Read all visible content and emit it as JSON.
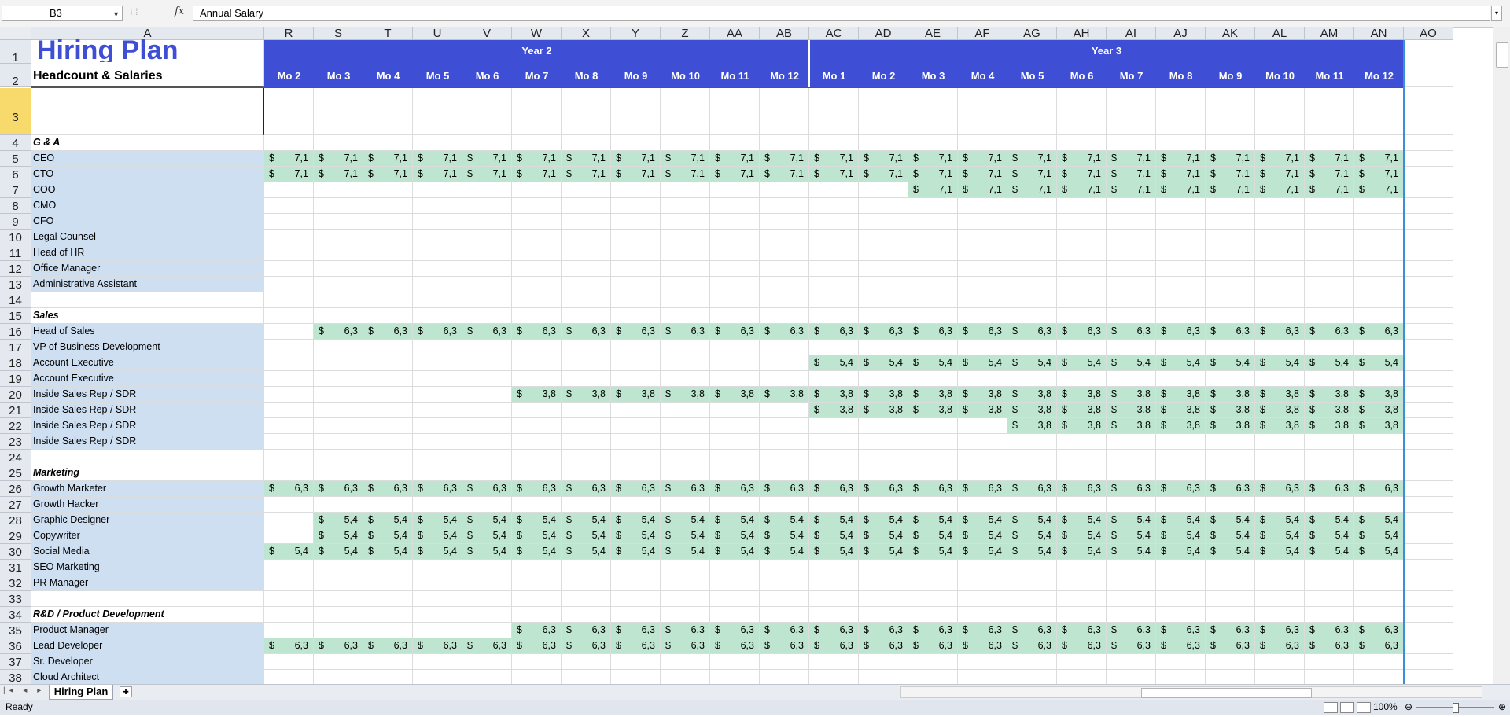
{
  "formula_bar": {
    "name_box": "B3",
    "formula": "Annual Salary",
    "fx": "fx"
  },
  "columns": [
    "A",
    "R",
    "S",
    "T",
    "U",
    "V",
    "W",
    "X",
    "Y",
    "Z",
    "AA",
    "AB",
    "AC",
    "AD",
    "AE",
    "AF",
    "AG",
    "AH",
    "AI",
    "AJ",
    "AK",
    "AL",
    "AM",
    "AN",
    "AO"
  ],
  "header": {
    "title": "Hiring Plan",
    "subtitle": "Headcount & Salaries",
    "year_labels": [
      "Year 2",
      "Year 3"
    ],
    "months": [
      "Mo 2",
      "Mo 3",
      "Mo 4",
      "Mo 5",
      "Mo 6",
      "Mo 7",
      "Mo 8",
      "Mo 9",
      "Mo 10",
      "Mo 11",
      "Mo 12",
      "Mo 1",
      "Mo 2",
      "Mo 3",
      "Mo 4",
      "Mo 5",
      "Mo 6",
      "Mo 7",
      "Mo 8",
      "Mo 9",
      "Mo 10",
      "Mo 11",
      "Mo 12"
    ]
  },
  "currency_symbol": "$",
  "rows": [
    {
      "n": "3",
      "kind": "blank"
    },
    {
      "n": "4",
      "kind": "cat",
      "label": "G & A"
    },
    {
      "n": "5",
      "kind": "role",
      "label": "CEO",
      "start": 0,
      "value": "7,1"
    },
    {
      "n": "6",
      "kind": "role",
      "label": "CTO",
      "start": 0,
      "value": "7,1"
    },
    {
      "n": "7",
      "kind": "role",
      "label": "COO",
      "start": 13,
      "value": "7,1"
    },
    {
      "n": "8",
      "kind": "role",
      "label": "CMO",
      "start": -1
    },
    {
      "n": "9",
      "kind": "role",
      "label": "CFO",
      "start": -1
    },
    {
      "n": "10",
      "kind": "role",
      "label": "Legal Counsel",
      "start": -1
    },
    {
      "n": "11",
      "kind": "role",
      "label": "Head of HR",
      "start": -1
    },
    {
      "n": "12",
      "kind": "role",
      "label": "Office Manager",
      "start": -1
    },
    {
      "n": "13",
      "kind": "role",
      "label": "Administrative Assistant",
      "start": -1
    },
    {
      "n": "14",
      "kind": "gap"
    },
    {
      "n": "15",
      "kind": "cat",
      "label": "Sales"
    },
    {
      "n": "16",
      "kind": "role",
      "label": "Head of Sales",
      "start": 1,
      "value": "6,3"
    },
    {
      "n": "17",
      "kind": "role",
      "label": "VP of Business Development",
      "start": -1
    },
    {
      "n": "18",
      "kind": "role",
      "label": "Account Executive",
      "start": 11,
      "value": "5,4"
    },
    {
      "n": "19",
      "kind": "role",
      "label": "Account Executive",
      "start": -1
    },
    {
      "n": "20",
      "kind": "role",
      "label": "Inside Sales Rep / SDR",
      "start": 5,
      "value": "3,8"
    },
    {
      "n": "21",
      "kind": "role",
      "label": "Inside Sales Rep / SDR",
      "start": 11,
      "value": "3,8"
    },
    {
      "n": "22",
      "kind": "role",
      "label": "Inside Sales Rep / SDR",
      "start": 15,
      "value": "3,8"
    },
    {
      "n": "23",
      "kind": "role",
      "label": "Inside Sales Rep / SDR",
      "start": -1
    },
    {
      "n": "24",
      "kind": "gap"
    },
    {
      "n": "25",
      "kind": "cat",
      "label": "Marketing"
    },
    {
      "n": "26",
      "kind": "role",
      "label": "Growth Marketer",
      "start": 0,
      "value": "6,3"
    },
    {
      "n": "27",
      "kind": "role",
      "label": "Growth Hacker",
      "start": -1
    },
    {
      "n": "28",
      "kind": "role",
      "label": "Graphic Designer",
      "start": 1,
      "value": "5,4"
    },
    {
      "n": "29",
      "kind": "role",
      "label": "Copywriter",
      "start": 1,
      "value": "5,4"
    },
    {
      "n": "30",
      "kind": "role",
      "label": "Social Media",
      "start": 0,
      "value": "5,4"
    },
    {
      "n": "31",
      "kind": "role",
      "label": "SEO Marketing",
      "start": -1
    },
    {
      "n": "32",
      "kind": "role",
      "label": "PR Manager",
      "start": -1
    },
    {
      "n": "33",
      "kind": "gap"
    },
    {
      "n": "34",
      "kind": "cat",
      "label": "R&D / Product Development"
    },
    {
      "n": "35",
      "kind": "role",
      "label": "Product Manager",
      "start": 5,
      "value": "6,3"
    },
    {
      "n": "36",
      "kind": "role",
      "label": "Lead Developer",
      "start": 0,
      "value": "6,3"
    },
    {
      "n": "37",
      "kind": "role",
      "label": "Sr. Developer",
      "start": -1
    },
    {
      "n": "38",
      "kind": "role",
      "label": "Cloud Architect",
      "start": -1
    }
  ],
  "sheet_tab": "Hiring Plan",
  "status": {
    "ready": "Ready",
    "zoom": "100%"
  },
  "colors": {
    "header_band": "#3e4fd6",
    "label_fill": "#cfdff2",
    "money_fill": "#bde5d0"
  }
}
